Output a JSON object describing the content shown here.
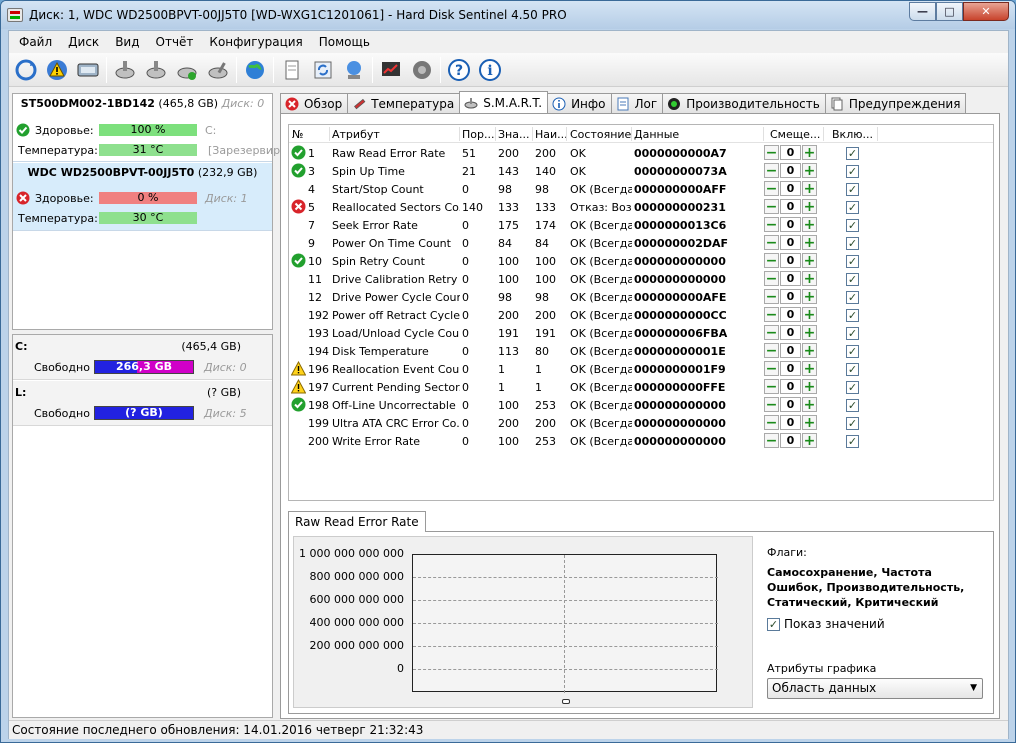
{
  "window": {
    "title": "Диск: 1, WDC WD2500BPVT-00JJ5T0 [WD-WXG1C1201061]  -  Hard Disk Sentinel 4.50 PRO",
    "min": "—",
    "max": "□",
    "close": "✕"
  },
  "menu": [
    "Файл",
    "Диск",
    "Вид",
    "Отчёт",
    "Конфигурация",
    "Помощь"
  ],
  "toolbar": [
    "refresh-icon",
    "warning-icon",
    "disk-icon",
    "disk-tool-icon",
    "disk-tool-icon",
    "disk-tool-icon",
    "disk-tool-icon",
    "globe-icon",
    "document-icon",
    "sync-icon",
    "network-icon",
    "chart-icon",
    "speaker-icon",
    "help-icon",
    "info-icon"
  ],
  "disks": [
    {
      "name": "ST500DM002-1BD142",
      "size": "(465,8 GB)",
      "disk_label": "Диск: 0",
      "health_label": "Здоровье:",
      "health": "100 %",
      "health_pct": 100,
      "health_color": "#7de07d",
      "health_extra": "C:",
      "temp_label": "Температура:",
      "temp": "31 °C",
      "temp_extra": "[Зарезервир"
    },
    {
      "name": "WDC WD2500BPVT-00JJ5T0",
      "size": "(232,9 GB)",
      "disk_label": "Диск: 1",
      "health_label": "Здоровье:",
      "health": "0 %",
      "health_pct": 0,
      "health_color": "#f08080",
      "temp_label": "Температура:",
      "temp": "30 °C"
    }
  ],
  "volumes": [
    {
      "letter": "C:",
      "size": "(465,4 GB)",
      "free_label": "Свободно",
      "free": "266,3 GB",
      "disk_label": "Диск: 0"
    },
    {
      "letter": "L:",
      "size": "(? GB)",
      "free_label": "Свободно",
      "free": "(? GB)",
      "disk_label": "Диск: 5"
    }
  ],
  "tabs": [
    {
      "label": "Обзор",
      "icon": "overview-icon"
    },
    {
      "label": "Температура",
      "icon": "thermometer-icon"
    },
    {
      "label": "S.M.A.R.T.",
      "icon": "disk-icon"
    },
    {
      "label": "Инфо",
      "icon": "info-icon"
    },
    {
      "label": "Лог",
      "icon": "log-icon"
    },
    {
      "label": "Производительность",
      "icon": "performance-icon"
    },
    {
      "label": "Предупреждения",
      "icon": "alerts-icon"
    }
  ],
  "smart": {
    "headers": [
      "№",
      "Атрибут",
      "Пор...",
      "Зна...",
      "Наи...",
      "Состояние",
      "Данные",
      "Смеще...",
      "Вклю..."
    ],
    "rows": [
      {
        "status": "ok",
        "id": "1",
        "name": "Raw Read Error Rate",
        "thr": "51",
        "val": "200",
        "worst": "200",
        "state": "OK",
        "data": "0000000000A7",
        "offset": "0"
      },
      {
        "status": "ok",
        "id": "3",
        "name": "Spin Up Time",
        "thr": "21",
        "val": "143",
        "worst": "140",
        "state": "OK",
        "data": "00000000073A",
        "offset": "0"
      },
      {
        "status": "",
        "id": "4",
        "name": "Start/Stop Count",
        "thr": "0",
        "val": "98",
        "worst": "98",
        "state": "OK (Всегда...",
        "data": "000000000AFF",
        "offset": "0"
      },
      {
        "status": "bad",
        "id": "5",
        "name": "Reallocated Sectors Co...",
        "thr": "140",
        "val": "133",
        "worst": "133",
        "state": "Отказ: Воз...",
        "data": "000000000231",
        "offset": "0"
      },
      {
        "status": "",
        "id": "7",
        "name": "Seek Error Rate",
        "thr": "0",
        "val": "175",
        "worst": "174",
        "state": "OK (Всегда...",
        "data": "0000000013C6",
        "offset": "0"
      },
      {
        "status": "",
        "id": "9",
        "name": "Power On Time Count",
        "thr": "0",
        "val": "84",
        "worst": "84",
        "state": "OK (Всегда...",
        "data": "000000002DAF",
        "offset": "0"
      },
      {
        "status": "ok",
        "id": "10",
        "name": "Spin Retry Count",
        "thr": "0",
        "val": "100",
        "worst": "100",
        "state": "OK (Всегда...",
        "data": "000000000000",
        "offset": "0"
      },
      {
        "status": "",
        "id": "11",
        "name": "Drive Calibration Retry ...",
        "thr": "0",
        "val": "100",
        "worst": "100",
        "state": "OK (Всегда...",
        "data": "000000000000",
        "offset": "0"
      },
      {
        "status": "",
        "id": "12",
        "name": "Drive Power Cycle Count",
        "thr": "0",
        "val": "98",
        "worst": "98",
        "state": "OK (Всегда...",
        "data": "000000000AFE",
        "offset": "0"
      },
      {
        "status": "",
        "id": "192",
        "name": "Power off Retract Cycle ...",
        "thr": "0",
        "val": "200",
        "worst": "200",
        "state": "OK (Всегда...",
        "data": "0000000000CC",
        "offset": "0"
      },
      {
        "status": "",
        "id": "193",
        "name": "Load/Unload Cycle Cou...",
        "thr": "0",
        "val": "191",
        "worst": "191",
        "state": "OK (Всегда...",
        "data": "000000006FBA",
        "offset": "0"
      },
      {
        "status": "",
        "id": "194",
        "name": "Disk Temperature",
        "thr": "0",
        "val": "113",
        "worst": "80",
        "state": "OK (Всегда...",
        "data": "00000000001E",
        "offset": "0"
      },
      {
        "status": "warn",
        "id": "196",
        "name": "Reallocation Event Count",
        "thr": "0",
        "val": "1",
        "worst": "1",
        "state": "OK (Всегда...",
        "data": "0000000001F9",
        "offset": "0"
      },
      {
        "status": "warn",
        "id": "197",
        "name": "Current Pending Sector...",
        "thr": "0",
        "val": "1",
        "worst": "1",
        "state": "OK (Всегда...",
        "data": "000000000FFE",
        "offset": "0"
      },
      {
        "status": "ok",
        "id": "198",
        "name": "Off-Line Uncorrectable ...",
        "thr": "0",
        "val": "100",
        "worst": "253",
        "state": "OK (Всегда...",
        "data": "000000000000",
        "offset": "0"
      },
      {
        "status": "",
        "id": "199",
        "name": "Ultra ATA CRC Error Co...",
        "thr": "0",
        "val": "200",
        "worst": "200",
        "state": "OK (Всегда...",
        "data": "000000000000",
        "offset": "0"
      },
      {
        "status": "",
        "id": "200",
        "name": "Write Error Rate",
        "thr": "0",
        "val": "100",
        "worst": "253",
        "state": "OK (Всегда...",
        "data": "000000000000",
        "offset": "0"
      }
    ]
  },
  "graph": {
    "tab_label": "Raw Read Error Rate",
    "flags_label": "Флаги:",
    "flags": "Самосохранение, Частота Ошибок, Производительность, Статический, Критический",
    "show_values_label": "Показ значений",
    "attrs_label": "Атрибуты графика",
    "combo_value": "Область данных",
    "y_ticks": [
      "1 000 000 000 000",
      "800 000 000 000",
      "600 000 000 000",
      "400 000 000 000",
      "200 000 000 000",
      "0"
    ]
  },
  "chart_data": {
    "type": "line",
    "series": [],
    "ylim": [
      0,
      1000000000000
    ],
    "yticks": [
      "1 000 000 000 000",
      "800 000 000 000",
      "600 000 000 000",
      "400 000 000 000",
      "200 000 000 000",
      "0"
    ],
    "grid": true
  },
  "status": "Состояние последнего обновления: 14.01.2016 четверг 21:32:43"
}
